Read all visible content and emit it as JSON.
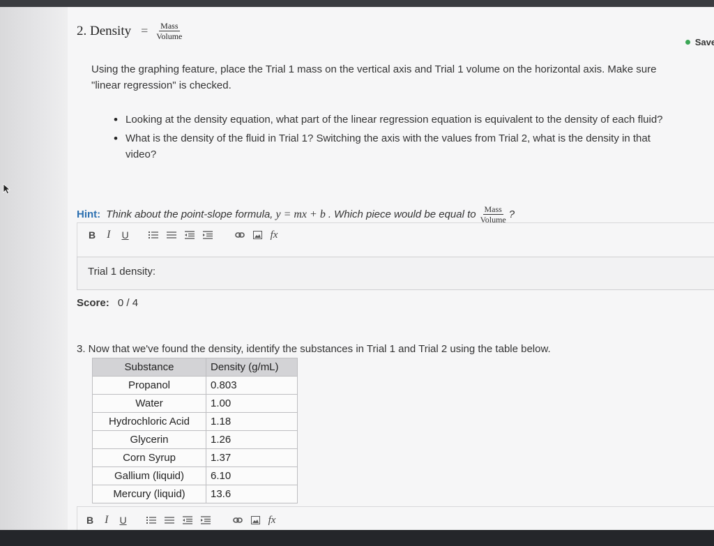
{
  "status": {
    "saved_label": "Saved",
    "saved_color": "#3aa655"
  },
  "q2": {
    "title": "2. Density",
    "eq": "=",
    "frac_num": "Mass",
    "frac_den": "Volume",
    "instruction": "Using the graphing feature, place the Trial 1 mass on the vertical axis and Trial 1 volume on the horizontal axis. Make sure \"linear regression\" is checked.",
    "bullets": [
      "Looking at the density equation, what part of the linear regression equation is equivalent to the density of each fluid?",
      "What is the density of the fluid in Trial 1? Switching the axis with the values from Trial 2, what is the density in that video?"
    ],
    "hint_label": "Hint:",
    "hint_text_1": "Think about the point-slope formula,",
    "hint_math": "y = mx + b",
    "hint_text_2": ". Which piece would be equal to",
    "hint_frac_num": "Mass",
    "hint_frac_den": "Volume",
    "hint_end": "?",
    "answer_text": "Trial 1 density:",
    "score_label": "Score:",
    "score_value": "0 / 4"
  },
  "toolbar": {
    "bold": "B",
    "italic": "I",
    "underline": "U",
    "fx": "fx",
    "icons": [
      "ordered-list-icon",
      "unordered-list-icon",
      "outdent-icon",
      "indent-icon",
      "link-icon",
      "image-icon",
      "formula-icon"
    ]
  },
  "q3": {
    "prompt": "3. Now that we've found the density, identify the substances in Trial 1 and Trial 2 using the table below.",
    "table": {
      "headers": [
        "Substance",
        "Density (g/mL)"
      ],
      "rows": [
        [
          "Propanol",
          "0.803"
        ],
        [
          "Water",
          "1.00"
        ],
        [
          "Hydrochloric Acid",
          "1.18"
        ],
        [
          "Glycerin",
          "1.26"
        ],
        [
          "Corn Syrup",
          "1.37"
        ],
        [
          "Gallium (liquid)",
          "6.10"
        ],
        [
          "Mercury (liquid)",
          "13.6"
        ]
      ]
    }
  }
}
